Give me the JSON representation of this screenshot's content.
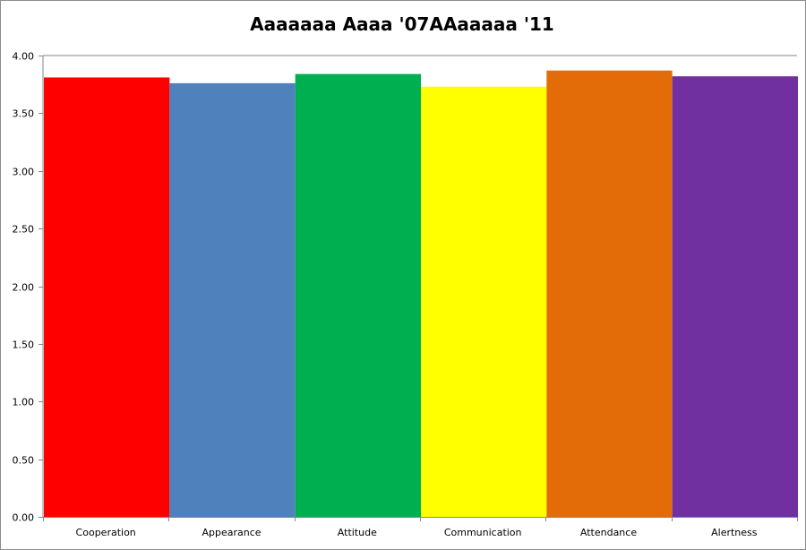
{
  "chart_data": {
    "type": "bar",
    "title": "Aaaaaaa Aaaa '07AAaaaaa '11",
    "xlabel": "",
    "ylabel": "",
    "categories": [
      "Cooperation",
      "Appearance",
      "Attitude",
      "Communication",
      "Attendance",
      "Alertness"
    ],
    "values": [
      3.81,
      3.76,
      3.84,
      3.73,
      3.87,
      3.82
    ],
    "colors": [
      "#ff0000",
      "#4f81bd",
      "#00b050",
      "#ffff00",
      "#e36c09",
      "#7030a0"
    ],
    "ylim": [
      0,
      4
    ],
    "yticks": [
      "0.00",
      "0.50",
      "1.00",
      "1.50",
      "2.00",
      "2.50",
      "3.00",
      "3.50",
      "4.00"
    ],
    "ytick_values": [
      0,
      0.5,
      1,
      1.5,
      2,
      2.5,
      3,
      3.5,
      4
    ],
    "grid": false,
    "legend": "none"
  }
}
